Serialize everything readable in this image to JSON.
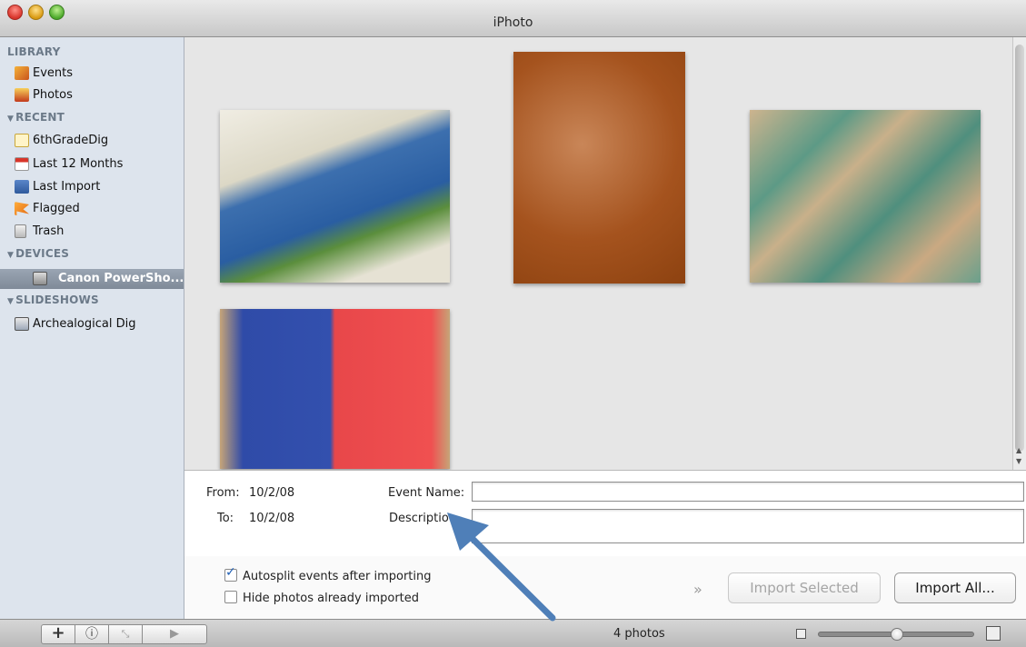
{
  "window": {
    "title": "iPhoto"
  },
  "sidebar": {
    "sections": {
      "library": "LIBRARY",
      "recent": "RECENT",
      "devices": "DEVICES",
      "slideshows": "SLIDESHOWS"
    },
    "library_items": [
      {
        "label": "Events"
      },
      {
        "label": "Photos"
      }
    ],
    "recent_items": [
      {
        "label": "6thGradeDig"
      },
      {
        "label": "Last 12 Months"
      },
      {
        "label": "Last Import"
      },
      {
        "label": "Flagged"
      },
      {
        "label": "Trash"
      }
    ],
    "device_items": [
      {
        "label": "Canon PowerSho..."
      }
    ],
    "slideshow_items": [
      {
        "label": "Archealogical Dig"
      }
    ]
  },
  "info": {
    "from_label": "From:",
    "from_value": "10/2/08",
    "to_label": "To:",
    "to_value": "10/2/08",
    "event_name_label": "Event Name:",
    "event_name_value": "",
    "description_label": "Descriptio",
    "description_value": ""
  },
  "import": {
    "autosplit_label": "Autosplit events after importing",
    "autosplit_checked": true,
    "hide_label": "Hide photos already imported",
    "hide_checked": false,
    "import_selected_label": "Import Selected",
    "import_all_label": "Import All..."
  },
  "statusbar": {
    "photo_count": "4 photos",
    "zoom_level": 0.5
  },
  "colors": {
    "annotation_arrow": "#4f7fb8",
    "selection": "#8a95a3"
  }
}
